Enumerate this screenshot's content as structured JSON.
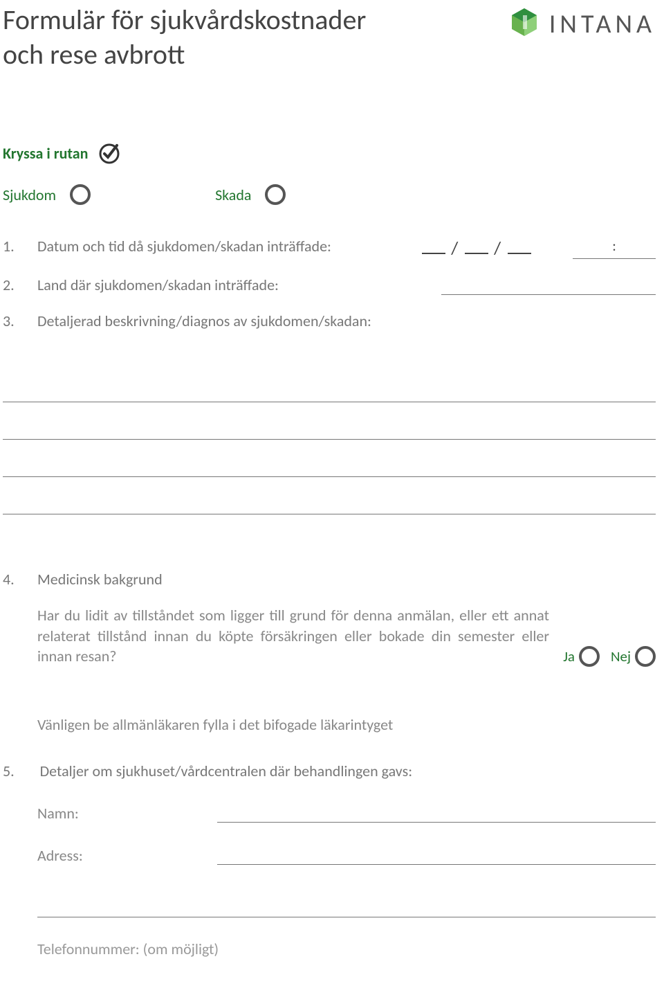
{
  "header": {
    "title_line1": "Formulär för sjukvårdskostnader",
    "title_line2": "och rese avbrott",
    "brand": "INTANA"
  },
  "tick": {
    "label": "Kryssa i rutan",
    "option1": "Sjukdom",
    "option2": "Skada"
  },
  "questions": {
    "q1_num": "1.",
    "q1_text": "Datum och tid då sjukdomen/skadan inträffade:",
    "q1_date_sep": "/",
    "q1_time_sep": ":",
    "q2_num": "2.",
    "q2_text": "Land där sjukdomen/skadan inträffade:",
    "q3_num": "3.",
    "q3_text": "Detaljerad beskrivning/diagnos av sjukdomen/skadan:",
    "q4_num": "4.",
    "q4_text": "Medicinsk bakgrund",
    "q4_body": "Har du lidit av tillståndet som ligger till grund för denna anmälan, eller ett annat relaterat tillstånd innan du köpte försäkringen eller bokade din semester eller innan resan?",
    "q4_yes": "Ja",
    "q4_no": "Nej",
    "gp_note": "Vänligen be allmänläkaren fylla i det bifogade läkarintyget",
    "q5_num": "5.",
    "q5_text": "Detaljer om sjukhuset/vårdcentralen där behandlingen gavs:",
    "q5_name": "Namn:",
    "q5_address": "Adress:",
    "q5_phone": "Telefonnummer: (om möjligt)"
  }
}
